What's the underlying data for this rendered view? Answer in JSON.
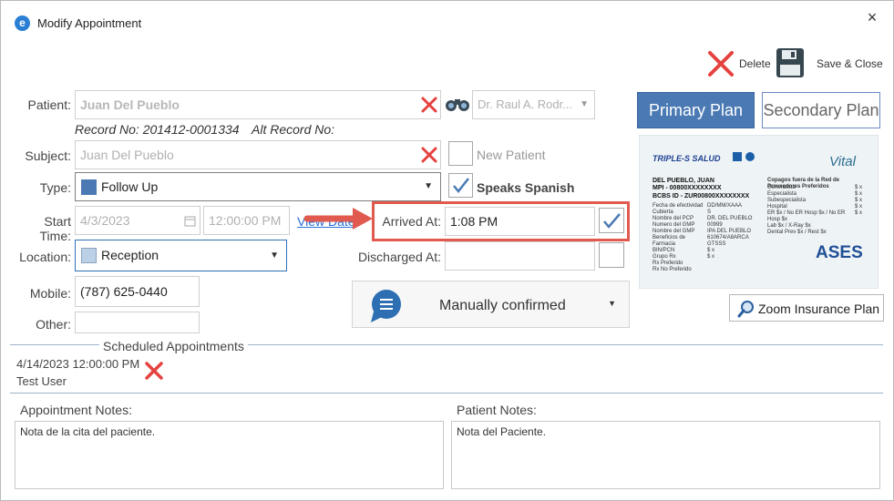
{
  "window": {
    "title": "Modify Appointment",
    "icon": "app-e-icon",
    "close": "×"
  },
  "toolbar": {
    "delete_label": "Delete",
    "save_close_label": "Save & Close"
  },
  "patient": {
    "label": "Patient:",
    "value": "Juan Del Pueblo",
    "record_no": "Record No: 201412-0001334",
    "alt_record": "Alt Record No:",
    "provider": "Dr. Raul A. Rodr..."
  },
  "subject": {
    "label": "Subject:",
    "value": "Juan Del Pueblo",
    "new_patient_label": "New Patient"
  },
  "type": {
    "label": "Type:",
    "value": "Follow Up",
    "color": "#4a79b3",
    "speaks_spanish_label": "Speaks Spanish"
  },
  "start_time": {
    "label": "Start Time:",
    "date": "4/3/2023",
    "time": "12:00:00 PM",
    "view_date_link": "View Date"
  },
  "arrived": {
    "label": "Arrived At:",
    "value": "1:08 PM"
  },
  "location": {
    "label": "Location:",
    "value": "Reception",
    "color": "#bcd0e6"
  },
  "discharged": {
    "label": "Discharged At:",
    "value": ""
  },
  "mobile": {
    "label": "Mobile:",
    "value": "(787) 625-0440"
  },
  "other": {
    "label": "Other:",
    "value": ""
  },
  "confirmation": {
    "value": "Manually confirmed"
  },
  "plans": {
    "primary": "Primary Plan",
    "secondary": "Secondary Plan",
    "zoom": "Zoom Insurance Plan"
  },
  "insurance_card": {
    "brand": "TRIPLE-S SALUD",
    "vital": "Vital",
    "name": "DEL PUEBLO, JUAN",
    "mpi": "MPI - 00800XXXXXXXX",
    "bcbs": "BCBS ID - ZUR00800XXXXXXXX",
    "left_rows": [
      "Fecha de efectividad",
      "Cubierta",
      "Nombre del PCP",
      "Numero del GMP",
      "Nombre del GMP",
      "Beneficios de Farmacia",
      "BIN/PCN",
      "Grupo Rx",
      "Rx Preferido",
      "Rx No Preferido"
    ],
    "left_values": [
      "DD/MM/XAAA",
      "S",
      "DR. DEL PUEBLO",
      "00999",
      "IPA DEL PUEBLO",
      "",
      "610674/A8ARCA",
      "GTSSS",
      "$ x",
      "$ x"
    ],
    "right_header": "Copagos fuera de la Red de Proveedores Preferidos",
    "right_rows": [
      "Generalista",
      "Especialista",
      "Subespecialista",
      "Hospital",
      "ER $x / No ER Hosp $x / No ER Hosp $x",
      "Lab $x / X-Ray $x",
      "Dental Prev $x / Rest $x"
    ],
    "right_values": [
      "$ x",
      "$ x",
      "$ x",
      "$ x",
      "$ x",
      "",
      ""
    ],
    "ases": "ASES"
  },
  "scheduled": {
    "header": "Scheduled Appointments",
    "items": [
      {
        "datetime": "4/14/2023 12:00:00 PM",
        "user": "Test User"
      }
    ]
  },
  "notes": {
    "appointment_label": "Appointment Notes:",
    "appointment_text": "Nota de la cita del paciente.",
    "patient_label": "Patient Notes:",
    "patient_text": "Nota del Paciente."
  }
}
